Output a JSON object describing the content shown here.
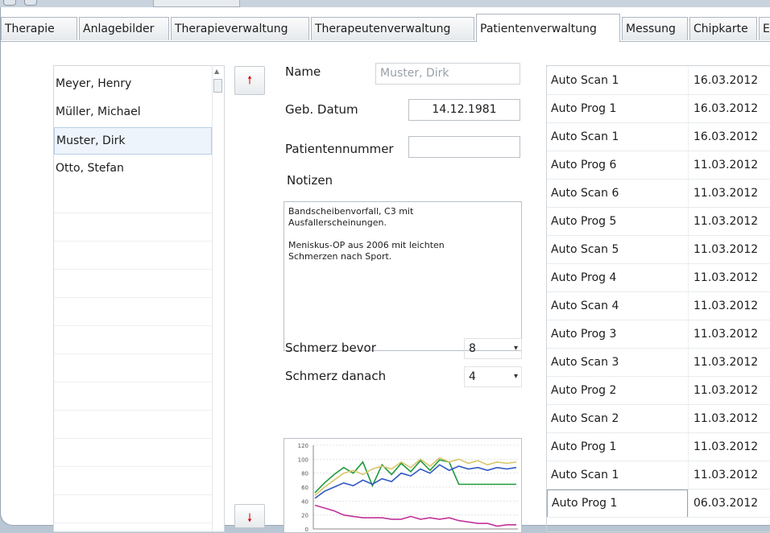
{
  "tabs": [
    {
      "label": "Therapie"
    },
    {
      "label": "Anlagebilder"
    },
    {
      "label": "Therapieverwaltung"
    },
    {
      "label": "Therapeutenverwaltung"
    },
    {
      "label": "Patientenverwaltung",
      "active": true
    },
    {
      "label": "Messung"
    },
    {
      "label": "Chipkarte"
    },
    {
      "label": "E"
    }
  ],
  "patients": [
    {
      "name": "Meyer, Henry"
    },
    {
      "name": "Müller, Michael"
    },
    {
      "name": "Muster, Dirk",
      "selected": true
    },
    {
      "name": "Otto, Stefan"
    }
  ],
  "nav": {
    "up_icon": "arrow-up-icon",
    "down_icon": "arrow-down-icon",
    "up_symbol": "🠕",
    "down_symbol": "🠗"
  },
  "form": {
    "name_label": "Name",
    "name_value": "Muster, Dirk",
    "birth_label": "Geb. Datum",
    "birth_value": "14.12.1981",
    "patno_label": "Patientennummer",
    "patno_value": "",
    "notes_label": "Notizen",
    "notes_value": "Bandscheibenvorfall, C3 mit\nAusfallerscheinungen.\n\nMeniskus-OP aus 2006 mit leichten\nSchmerzen nach Sport.",
    "pain_before_label": "Schmerz bevor",
    "pain_before_value": "8",
    "pain_after_label": "Schmerz danach",
    "pain_after_value": "4"
  },
  "sessions": [
    {
      "name": "Auto Scan 1",
      "date": "16.03.2012"
    },
    {
      "name": "Auto Prog 1",
      "date": "16.03.2012"
    },
    {
      "name": "Auto Scan 1",
      "date": "16.03.2012"
    },
    {
      "name": "Auto Prog 6",
      "date": "11.03.2012"
    },
    {
      "name": "Auto Scan 6",
      "date": "11.03.2012"
    },
    {
      "name": "Auto Prog 5",
      "date": "11.03.2012"
    },
    {
      "name": "Auto Scan 5",
      "date": "11.03.2012"
    },
    {
      "name": "Auto Prog 4",
      "date": "11.03.2012"
    },
    {
      "name": "Auto Scan 4",
      "date": "11.03.2012"
    },
    {
      "name": "Auto Prog 3",
      "date": "11.03.2012"
    },
    {
      "name": "Auto Scan 3",
      "date": "11.03.2012"
    },
    {
      "name": "Auto Prog 2",
      "date": "11.03.2012"
    },
    {
      "name": "Auto Scan 2",
      "date": "11.03.2012"
    },
    {
      "name": "Auto Prog 1",
      "date": "11.03.2012"
    },
    {
      "name": "Auto Scan 1",
      "date": "11.03.2012"
    },
    {
      "name": "Auto Prog 1",
      "date": "06.03.2012",
      "selected": true
    }
  ],
  "chart_data": {
    "type": "line",
    "ylim": [
      0,
      120
    ],
    "yticks": [
      "120",
      "100",
      "80",
      "60",
      "40",
      "20",
      "0"
    ],
    "series": [
      {
        "color": "#1f9a3c",
        "values": [
          52,
          66,
          78,
          88,
          80,
          96,
          62,
          92,
          78,
          94,
          82,
          98,
          84,
          99,
          96,
          64,
          64,
          64,
          64,
          64,
          64,
          64
        ]
      },
      {
        "color": "#d9c66a",
        "values": [
          48,
          60,
          70,
          80,
          84,
          78,
          86,
          90,
          86,
          96,
          88,
          100,
          90,
          102,
          96,
          100,
          94,
          98,
          92,
          96,
          94,
          96
        ]
      },
      {
        "color": "#2f57c2",
        "values": [
          44,
          54,
          60,
          66,
          62,
          70,
          64,
          72,
          68,
          80,
          76,
          86,
          80,
          92,
          84,
          90,
          86,
          88,
          84,
          88,
          86,
          88
        ]
      },
      {
        "color": "#c2329a",
        "values": [
          34,
          30,
          26,
          20,
          18,
          16,
          16,
          16,
          14,
          14,
          18,
          14,
          16,
          14,
          16,
          12,
          10,
          8,
          8,
          4,
          6,
          6
        ]
      }
    ]
  }
}
